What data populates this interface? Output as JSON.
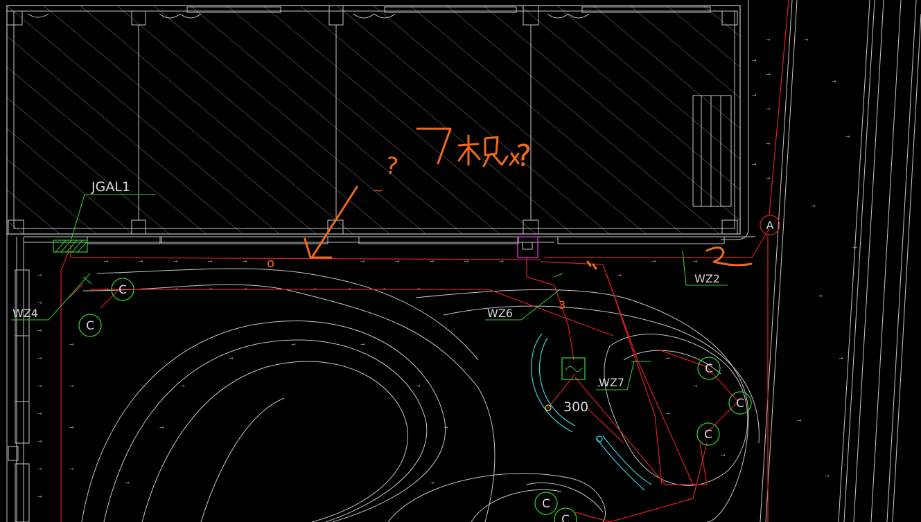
{
  "drawing": {
    "labels": {
      "jgal1": "JGAL1",
      "wz2": "WZ2",
      "wz4": "WZ4",
      "wz6": "WZ6",
      "wz7": "WZ7",
      "dim_300": "300",
      "axis_a": "A"
    },
    "light_pole_symbol": "C",
    "annotations": {
      "question_top": "?",
      "question_right": "?",
      "circle_mark": "o",
      "number_3": "3",
      "number_2": "2"
    },
    "colors": {
      "background": "#000000",
      "wall_lines": "#c8c8c8",
      "hatch": "#7a7a7a",
      "cable": "#e02020",
      "leader": "#2fd02f",
      "handwriting": "#f06a1e",
      "fixture_cyan": "#3ad6e6",
      "box_magenta": "#e040e0"
    }
  }
}
